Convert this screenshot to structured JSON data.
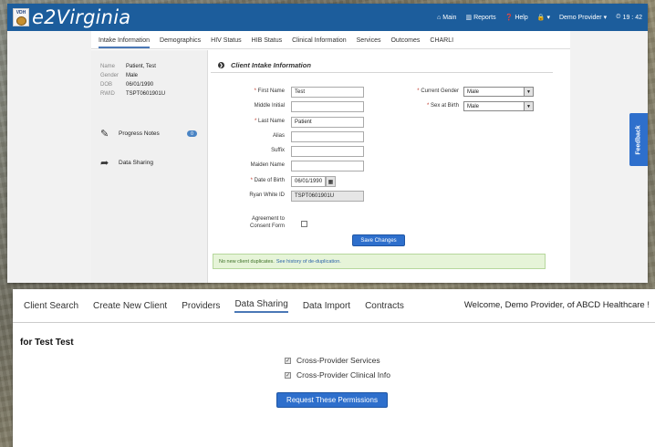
{
  "top_app": {
    "brand": "e2Virginia",
    "logo_text": "VDH",
    "nav": [
      {
        "icon": "home-icon",
        "glyph": "⌂",
        "label": "Main"
      },
      {
        "icon": "bar-chart-icon",
        "glyph": "▥",
        "label": "Reports"
      },
      {
        "icon": "help-icon",
        "glyph": "❓",
        "label": "Help"
      },
      {
        "icon": "lock-icon",
        "glyph": "🔒",
        "label": "▾"
      },
      {
        "icon": "user-menu",
        "glyph": "",
        "label": "Demo Provider ▾"
      },
      {
        "icon": "clock-icon",
        "glyph": "⏲",
        "label": "19 : 42"
      }
    ],
    "tabs": [
      "Intake Information",
      "Demographics",
      "HIV Status",
      "HIB Status",
      "Clinical Information",
      "Services",
      "Outcomes",
      "CHARLI"
    ],
    "active_tab": "Intake Information",
    "client_info": [
      {
        "key": "Name",
        "value": "Patient, Test"
      },
      {
        "key": "Gender",
        "value": "Male"
      },
      {
        "key": "DOB",
        "value": "06/01/1990"
      },
      {
        "key": "RWID",
        "value": "TSPT0601901U"
      }
    ],
    "side_links": {
      "progress_notes": "Progress Notes",
      "progress_notes_badge": "0",
      "data_sharing": "Data Sharing"
    },
    "section_title": "Client Intake Information",
    "form": {
      "first_name_label": "First Name",
      "first_name_value": "Test",
      "middle_initial_label": "Middle Initial",
      "middle_initial_value": "",
      "last_name_label": "Last Name",
      "last_name_value": "Patient",
      "alias_label": "Alias",
      "alias_value": "",
      "suffix_label": "Suffix",
      "suffix_value": "",
      "maiden_name_label": "Maiden Name",
      "maiden_name_value": "",
      "dob_label": "Date of Birth",
      "dob_value": "06/01/1990",
      "ryan_white_label": "Ryan White ID",
      "ryan_white_value": "TSPT0601901U",
      "agreement_label_1": "Agreement to",
      "agreement_label_2": "Consent Form",
      "current_gender_label": "Current Gender",
      "current_gender_value": "Male",
      "sex_at_birth_label": "Sex at Birth",
      "sex_at_birth_value": "Male",
      "required_mark": "*",
      "save_button": "Save Changes"
    },
    "dedup_message": "No new client duplicates.",
    "dedup_link": "See history of de-duplication.",
    "feedback": "Feedback"
  },
  "bottom_app": {
    "tabs": [
      "Client Search",
      "Create New Client",
      "Providers",
      "Data Sharing",
      "Data Import",
      "Contracts"
    ],
    "active_tab": "Data Sharing",
    "welcome": "Welcome, Demo Provider, of ABCD Healthcare !",
    "for_title": "for Test Test",
    "permissions": [
      {
        "label": "Cross-Provider Services",
        "checked": true
      },
      {
        "label": "Cross-Provider Clinical Info",
        "checked": true
      }
    ],
    "request_button": "Request These Permissions"
  }
}
